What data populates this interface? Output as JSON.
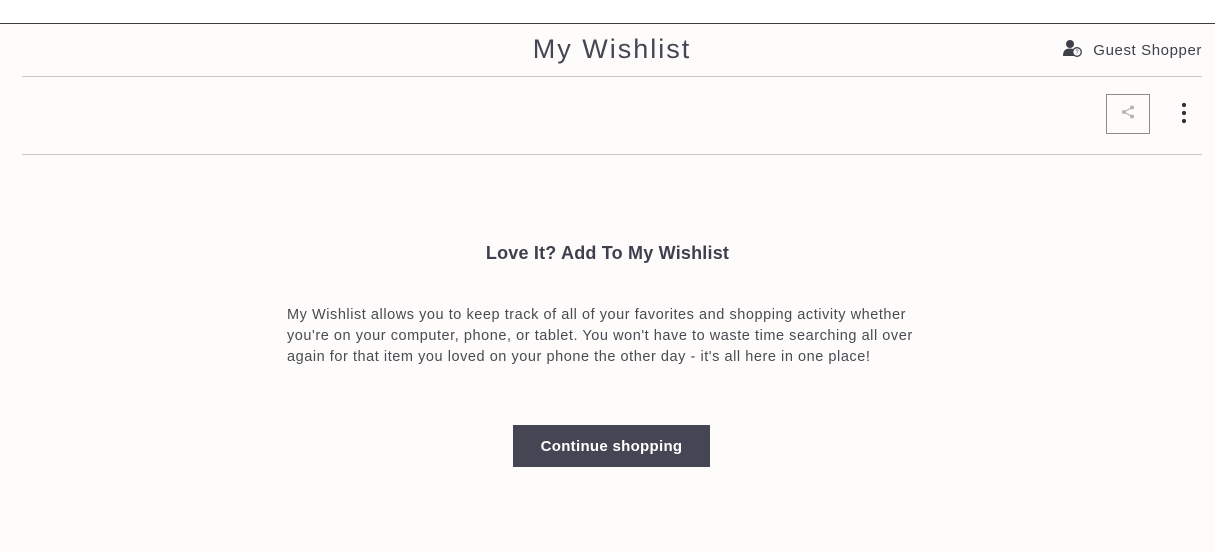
{
  "header": {
    "title": "My Wishlist",
    "account_label": "Guest Shopper",
    "account_icon": "user-icon"
  },
  "toolbar": {
    "share_icon": "share-icon",
    "more_icon": "more-vertical-icon"
  },
  "empty_state": {
    "heading": "Love It? Add To My Wishlist",
    "description": "My Wishlist allows you to keep track of all of your favorites and shopping activity whether you're on your computer, phone, or tablet. You won't have to waste time searching all over again for that item you loved on your phone the other day - it's all here in one place!",
    "button_label": "Continue shopping"
  },
  "colors": {
    "primary_dark": "#454553",
    "background": "#fdfcfb",
    "divider": "#c9c9c9"
  }
}
